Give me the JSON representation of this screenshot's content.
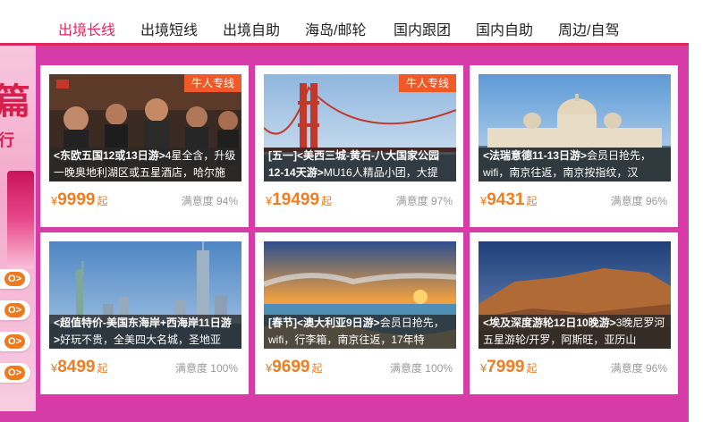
{
  "nav": {
    "tabs": [
      {
        "label": "出境长线",
        "active": true
      },
      {
        "label": "出境短线",
        "active": false
      },
      {
        "label": "出境自助",
        "active": false
      },
      {
        "label": "海岛/邮轮",
        "active": false
      },
      {
        "label": "国内跟团",
        "active": false
      },
      {
        "label": "国内自助",
        "active": false
      },
      {
        "label": "周边/自驾",
        "active": false
      }
    ],
    "accent_color": "#e0245e"
  },
  "banner": {
    "big_char": "篇",
    "small_char": "行",
    "pill_buttons": [
      "O>",
      "O>",
      "O>",
      "O>"
    ],
    "background_color": "#d63ba8"
  },
  "cards": [
    {
      "badge": "牛人专线",
      "title": "<东欧五国12或13日游>",
      "desc": "4星全含，升级一晚奥地利湖区或五星酒店，哈尔施",
      "yen": "¥",
      "price": "9999",
      "price_suffix": "起",
      "satisfaction": "满意度 94%",
      "image": "movie-poster-crowd"
    },
    {
      "badge": "牛人专线",
      "title": "[五一]<美西三城-黄石-八大国家公园12-14天游>",
      "desc": "MU16人精品小团，大提",
      "yen": "¥",
      "price": "19499",
      "price_suffix": "起",
      "satisfaction": "满意度 97%",
      "image": "golden-gate-bridge"
    },
    {
      "badge": "",
      "title": "<法瑞意德11-13日游>",
      "desc": "会员日抢先，wifi，南京往返，南京按指纹，汉",
      "yen": "¥",
      "price": "9431",
      "price_suffix": "起",
      "satisfaction": "满意度 96%",
      "image": "venice-basilica"
    },
    {
      "badge": "",
      "title": "<超值特价-美国东海岸+西海岸11日游>",
      "desc": "好玩不贵，全美四大名城，圣地亚",
      "yen": "¥",
      "price": "8499",
      "price_suffix": "起",
      "satisfaction": "满意度 100%",
      "image": "statue-of-liberty"
    },
    {
      "badge": "",
      "title": "[春节]<澳大利亚9日游>",
      "desc": "会员日抢先，wifi，行李箱，南京往返，17年特",
      "yen": "¥",
      "price": "9699",
      "price_suffix": "起",
      "satisfaction": "满意度 100%",
      "image": "sunset-beach"
    },
    {
      "badge": "",
      "title": "<埃及深度游轮12日10晚游>",
      "desc": "3晚尼罗河五星游轮/开罗，阿斯旺，亚历山",
      "yen": "¥",
      "price": "7999",
      "price_suffix": "起",
      "satisfaction": "满意度 96%",
      "image": "desert-cliffs"
    }
  ]
}
